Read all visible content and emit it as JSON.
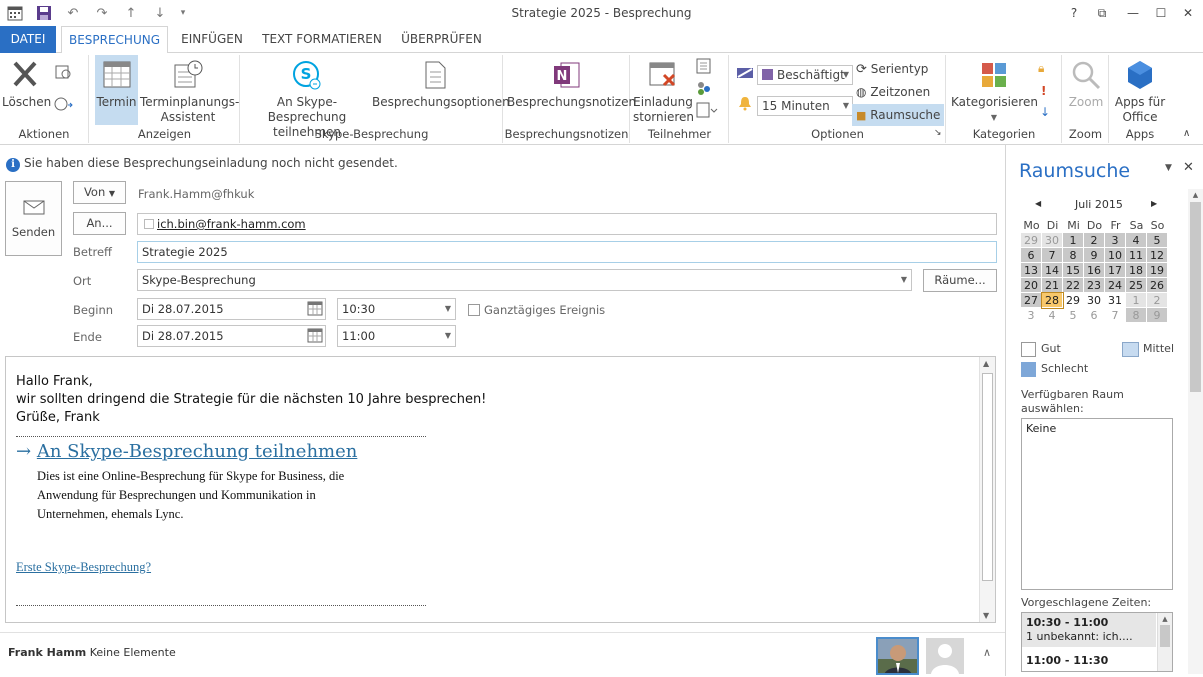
{
  "window": {
    "title": "Strategie 2025 - Besprechung",
    "help": "?",
    "restore": "⧉",
    "minimize": "—",
    "maximize": "☐",
    "close": "✕"
  },
  "tabs": [
    "DATEI",
    "BESPRECHUNG",
    "EINFÜGEN",
    "TEXT FORMATIEREN",
    "ÜBERPRÜFEN"
  ],
  "ribbon": {
    "aktionen": {
      "label": "Aktionen",
      "delete": "Löschen"
    },
    "anzeigen": {
      "label": "Anzeigen",
      "termin": "Termin",
      "assistant_l1": "Terminplanungs-",
      "assistant_l2": "Assistent"
    },
    "skype": {
      "label": "Skype-Besprechung",
      "join_l1": "An Skype-Besprechung",
      "join_l2": "teilnehmen",
      "options": "Besprechungsoptionen"
    },
    "notes": {
      "label": "Besprechungsnotizen",
      "btn": "Besprechungsnotizen"
    },
    "teilnehmer": {
      "label": "Teilnehmer",
      "cancel_l1": "Einladung",
      "cancel_l2": "stornieren"
    },
    "optionen": {
      "label": "Optionen",
      "status": "Beschäftigt",
      "reminder": "15 Minuten",
      "serientyp": "Serientyp",
      "zeitzonen": "Zeitzonen",
      "raumsuche": "Raumsuche"
    },
    "kategorien": {
      "label": "Kategorien",
      "btn": "Kategorisieren"
    },
    "zoom": {
      "label": "Zoom",
      "btn": "Zoom"
    },
    "apps": {
      "label": "Apps",
      "l1": "Apps für",
      "l2": "Office"
    }
  },
  "info": "Sie haben diese Besprechungseinladung noch nicht gesendet.",
  "form": {
    "send": "Senden",
    "von": "Von",
    "from_value": "Frank.Hamm@fhkuk",
    "an": "An...",
    "to_value": "ich.bin@frank-hamm.com",
    "betreff_label": "Betreff",
    "betreff_value": "Strategie 2025",
    "ort_label": "Ort",
    "ort_value": "Skype-Besprechung",
    "raeume": "Räume...",
    "beginn_label": "Beginn",
    "beginn_date": "Di 28.07.2015",
    "beginn_time": "10:30",
    "allday": "Ganztägiges Ereignis",
    "ende_label": "Ende",
    "ende_date": "Di 28.07.2015",
    "ende_time": "11:00"
  },
  "body": {
    "line1": "Hallo Frank,",
    "line2": "wir sollten dringend die Strategie für die nächsten 10 Jahre besprechen!",
    "line3": "Grüße, Frank",
    "skype_link": "An Skype-Besprechung teilnehmen",
    "desc1": "Dies ist eine Online-Besprechung für Skype for Business, die",
    "desc2": "Anwendung für Besprechungen und Kommunikation in",
    "desc3": "Unternehmen, ehemals Lync.",
    "first_link": "Erste Skype-Besprechung?"
  },
  "roompane": {
    "title": "Raumsuche",
    "month": "Juli 2015",
    "weekdays": [
      "Mo",
      "Di",
      "Mi",
      "Do",
      "Fr",
      "Sa",
      "So"
    ],
    "weeks": [
      [
        "29",
        "30",
        "1",
        "2",
        "3",
        "4",
        "5"
      ],
      [
        "6",
        "7",
        "8",
        "9",
        "10",
        "11",
        "12"
      ],
      [
        "13",
        "14",
        "15",
        "16",
        "17",
        "18",
        "19"
      ],
      [
        "20",
        "21",
        "22",
        "23",
        "24",
        "25",
        "26"
      ],
      [
        "27",
        "28",
        "29",
        "30",
        "31",
        "1",
        "2"
      ],
      [
        "3",
        "4",
        "5",
        "6",
        "7",
        "8",
        "9"
      ]
    ],
    "legend_gut": "Gut",
    "legend_mittel": "Mittel",
    "legend_schlecht": "Schlecht",
    "room_label_l1": "Verfügbaren Raum",
    "room_label_l2": "auswählen:",
    "room_value": "Keine",
    "suggested_label": "Vorgeschlagene Zeiten:",
    "sugg1_time": "10:30 - 11:00",
    "sugg1_info": "1 unbekannt: ich....",
    "sugg2_time": "11:00 - 11:30"
  },
  "status": {
    "name": "Frank Hamm",
    "items": "Keine Elemente"
  },
  "colors": {
    "accent": "#2a6fc4",
    "selected": "#c5dcf0",
    "calendar_busy": "#c8c8c8",
    "today": "#f8c86b"
  }
}
